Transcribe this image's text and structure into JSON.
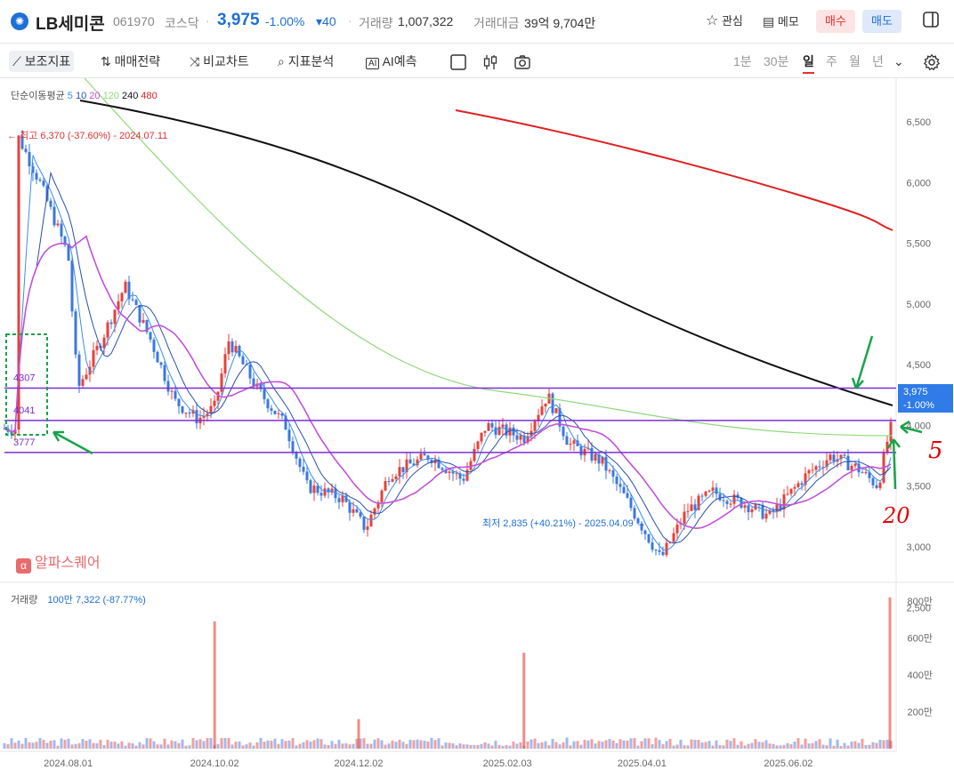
{
  "header": {
    "logo_icon": "coin-logo-icon",
    "name": "LB세미콘",
    "code": "061970",
    "market": "코스닥",
    "separator": "·",
    "price": "3,975",
    "change_pct": "-1.00%",
    "change_abs": "▾40",
    "volume_label": "거래량",
    "volume": "1,007,322",
    "amount_label": "거래대금",
    "amount": "39억 9,704만",
    "watch_label": "관심",
    "memo_label": "메모",
    "buy_label": "매수",
    "sell_label": "매도"
  },
  "toolbar": {
    "indicators": "보조지표",
    "strategy": "매매전략",
    "compare": "비교차트",
    "analysis": "지표분석",
    "ai": "AI예측",
    "periods": [
      "1분",
      "30분",
      "일",
      "주",
      "월",
      "년"
    ],
    "active_period": "일"
  },
  "legend": {
    "ma_title": "단순이동평균",
    "ma": [
      {
        "label": "5",
        "color": "#3b8ee8"
      },
      {
        "label": "10",
        "color": "#2c4fb0"
      },
      {
        "label": "20",
        "color": "#c152d8"
      },
      {
        "label": "120",
        "color": "#8fd97a"
      },
      {
        "label": "240",
        "color": "#111111"
      },
      {
        "label": "480",
        "color": "#e02020"
      }
    ],
    "volume_title": "거래량",
    "volume_value": "100만 7,322 (-87.77%)"
  },
  "annotations": {
    "high": "최고 6,370 (-37.60%) - 2024.07.11",
    "low": "최저 2,835 (+40.21%) - 2025.04.09",
    "current_price": "3,975",
    "current_pct": "-1.00%",
    "levels": [
      "4307",
      "4041",
      "3777"
    ],
    "handwritten_5": "5",
    "handwritten_20": "20"
  },
  "watermark": "알파스퀘어",
  "chart_data": {
    "type": "candlestick",
    "y_axis_ticks": [
      "6,500",
      "6,000",
      "5,500",
      "5,000",
      "4,500",
      "4,000",
      "3,500",
      "3,000",
      "2,500"
    ],
    "y_axis_values": [
      6500,
      6000,
      5500,
      5000,
      4500,
      4000,
      3500,
      3000,
      2500
    ],
    "volume_ticks": [
      "800만",
      "600만",
      "400만",
      "200만"
    ],
    "volume_tick_values": [
      8000000,
      6000000,
      4000000,
      2000000
    ],
    "x_axis_ticks": [
      "2024.08.01",
      "2024.10.02",
      "2024.12.02",
      "2025.02.03",
      "2025.04.01",
      "2025.06.02"
    ],
    "horizontal_levels": [
      4307,
      4041,
      3777
    ],
    "price_path": [
      [
        "2024.07.11",
        6370
      ],
      [
        "2024.07.20",
        6000
      ],
      [
        "2024.08.01",
        5400
      ],
      [
        "2024.08.05",
        4300
      ],
      [
        "2024.08.15",
        4700
      ],
      [
        "2024.08.25",
        5150
      ],
      [
        "2024.09.05",
        4700
      ],
      [
        "2024.09.15",
        4200
      ],
      [
        "2024.09.25",
        4050
      ],
      [
        "2024.10.02",
        4150
      ],
      [
        "2024.10.08",
        4700
      ],
      [
        "2024.10.20",
        4300
      ],
      [
        "2024.11.01",
        4000
      ],
      [
        "2024.11.10",
        3500
      ],
      [
        "2024.11.25",
        3400
      ],
      [
        "2024.12.05",
        3150
      ],
      [
        "2024.12.15",
        3600
      ],
      [
        "2025.01.01",
        3750
      ],
      [
        "2025.01.15",
        3550
      ],
      [
        "2025.01.25",
        4000
      ],
      [
        "2025.02.10",
        3900
      ],
      [
        "2025.02.20",
        4250
      ],
      [
        "2025.03.01",
        3850
      ],
      [
        "2025.03.15",
        3700
      ],
      [
        "2025.03.25",
        3400
      ],
      [
        "2025.04.09",
        2900
      ],
      [
        "2025.04.20",
        3300
      ],
      [
        "2025.05.01",
        3450
      ],
      [
        "2025.05.15",
        3350
      ],
      [
        "2025.05.25",
        3250
      ],
      [
        "2025.06.10",
        3600
      ],
      [
        "2025.06.20",
        3750
      ],
      [
        "2025.07.01",
        3650
      ],
      [
        "2025.07.10",
        3500
      ],
      [
        "2025.07.15",
        3975
      ]
    ],
    "volume_spikes": [
      [
        "2024.10.02",
        6900000
      ],
      [
        "2024.12.02",
        1600000
      ],
      [
        "2025.02.10",
        5200000
      ],
      [
        "2025.07.15",
        8200000
      ]
    ]
  }
}
